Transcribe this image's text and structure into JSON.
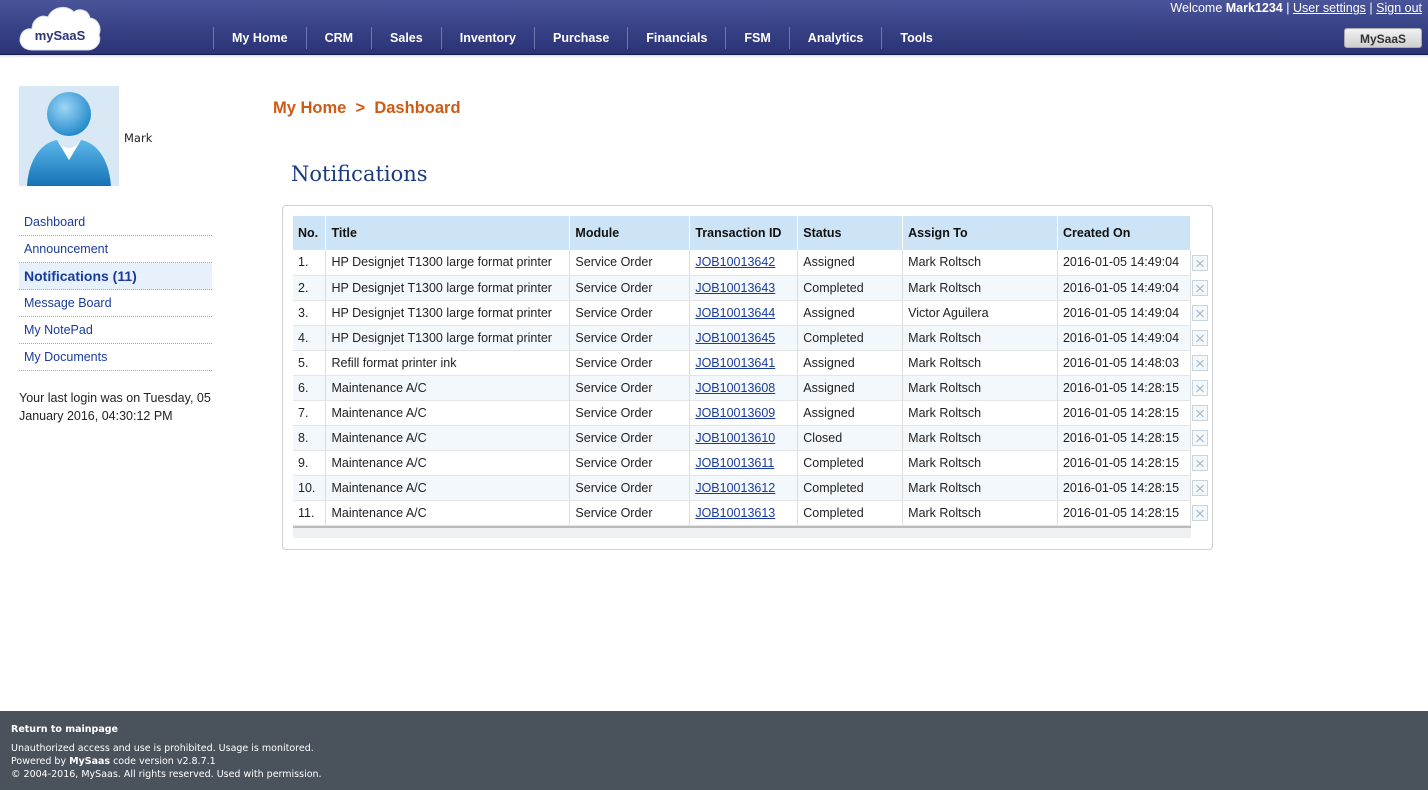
{
  "header": {
    "logo_text": "mySaaS",
    "nav": [
      "My Home",
      "CRM",
      "Sales",
      "Inventory",
      "Purchase",
      "Financials",
      "FSM",
      "Analytics",
      "Tools"
    ],
    "welcome_prefix": "Welcome ",
    "username": "Mark1234",
    "separator": " | ",
    "user_settings": "User settings",
    "sign_out": "Sign out",
    "app_button": "MySaaS"
  },
  "sidebar": {
    "name": "Mark",
    "items": [
      {
        "label": "Dashboard"
      },
      {
        "label": "Announcement"
      },
      {
        "label": "Notifications (11)",
        "active": true
      },
      {
        "label": "Message Board"
      },
      {
        "label": "My NotePad"
      },
      {
        "label": "My Documents"
      }
    ],
    "last_login": "Your last login was on Tuesday, 05 January 2016, 04:30:12 PM"
  },
  "breadcrumb": {
    "home": "My Home",
    "sep": ">",
    "current": "Dashboard"
  },
  "page_title": "Notifications",
  "table": {
    "columns": [
      "No.",
      "Title",
      "Module",
      "Transaction ID",
      "Status",
      "Assign To",
      "Created On"
    ],
    "rows": [
      [
        "1.",
        "HP Designjet T1300 large format printer",
        "Service Order",
        "JOB10013642",
        "Assigned",
        "Mark Roltsch",
        "2016-01-05 14:49:04"
      ],
      [
        "2.",
        "HP Designjet T1300 large format printer",
        "Service Order",
        "JOB10013643",
        "Completed",
        "Mark Roltsch",
        "2016-01-05 14:49:04"
      ],
      [
        "3.",
        "HP Designjet T1300 large format printer",
        "Service Order",
        "JOB10013644",
        "Assigned",
        "Victor Aguilera",
        "2016-01-05 14:49:04"
      ],
      [
        "4.",
        "HP Designjet T1300 large format printer",
        "Service Order",
        "JOB10013645",
        "Completed",
        "Mark Roltsch",
        "2016-01-05 14:49:04"
      ],
      [
        "5.",
        "Refill format printer ink",
        "Service Order",
        "JOB10013641",
        "Assigned",
        "Mark Roltsch",
        "2016-01-05 14:48:03"
      ],
      [
        "6.",
        "Maintenance A/C",
        "Service Order",
        "JOB10013608",
        "Assigned",
        "Mark Roltsch",
        "2016-01-05 14:28:15"
      ],
      [
        "7.",
        "Maintenance A/C",
        "Service Order",
        "JOB10013609",
        "Assigned",
        "Mark Roltsch",
        "2016-01-05 14:28:15"
      ],
      [
        "8.",
        "Maintenance A/C",
        "Service Order",
        "JOB10013610",
        "Closed",
        "Mark Roltsch",
        "2016-01-05 14:28:15"
      ],
      [
        "9.",
        "Maintenance A/C",
        "Service Order",
        "JOB10013611",
        "Completed",
        "Mark Roltsch",
        "2016-01-05 14:28:15"
      ],
      [
        "10.",
        "Maintenance A/C",
        "Service Order",
        "JOB10013612",
        "Completed",
        "Mark Roltsch",
        "2016-01-05 14:28:15"
      ],
      [
        "11.",
        "Maintenance A/C",
        "Service Order",
        "JOB10013613",
        "Completed",
        "Mark Roltsch",
        "2016-01-05 14:28:15"
      ]
    ]
  },
  "footer": {
    "return_link": "Return to mainpage",
    "line1": "Unauthorized access and use is prohibited. Usage is monitored.",
    "line2_prefix": "Powered by ",
    "line2_brand": "MySaas",
    "line2_suffix": " code version v2.8.7.1",
    "line3": "© 2004-2016, MySaas. All rights reserved. Used with permission."
  },
  "colors": {
    "header": "#3a4488",
    "breadcrumb": "#d05a14",
    "link": "#1a3b9c",
    "table_header": "#cde3f6",
    "footer": "#4a535c"
  }
}
